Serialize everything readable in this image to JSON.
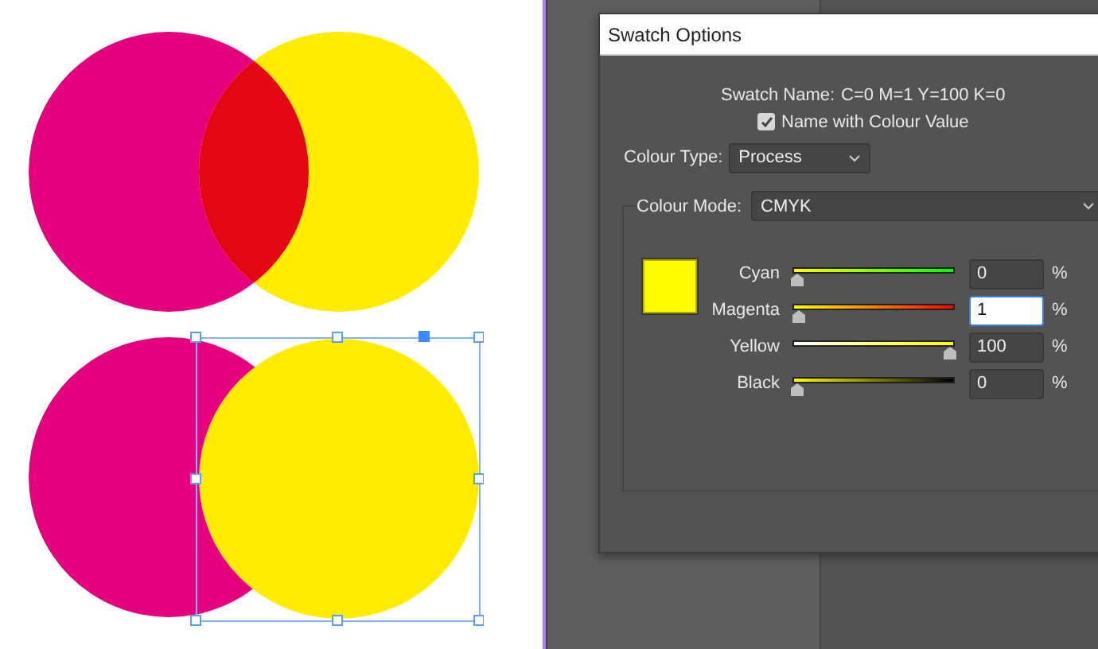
{
  "dialog": {
    "title": "Swatch Options",
    "swatch_name": {
      "label": "Swatch Name:",
      "value": "C=0 M=1 Y=100 K=0"
    },
    "name_with_value": {
      "label": "Name with Colour Value",
      "checked": true
    },
    "colour_type": {
      "label": "Colour Type:",
      "value": "Process"
    },
    "colour_mode": {
      "label": "Colour Mode:",
      "value": "CMYK"
    },
    "channels": [
      {
        "name": "Cyan",
        "level": 0,
        "value": "0",
        "unit": "%",
        "focused": false
      },
      {
        "name": "Magenta",
        "level": 0.01,
        "value": "1",
        "unit": "%",
        "focused": true
      },
      {
        "name": "Yellow",
        "level": 1,
        "value": "100",
        "unit": "%",
        "focused": false
      },
      {
        "name": "Black",
        "level": 0,
        "value": "0",
        "unit": "%",
        "focused": false
      }
    ]
  }
}
